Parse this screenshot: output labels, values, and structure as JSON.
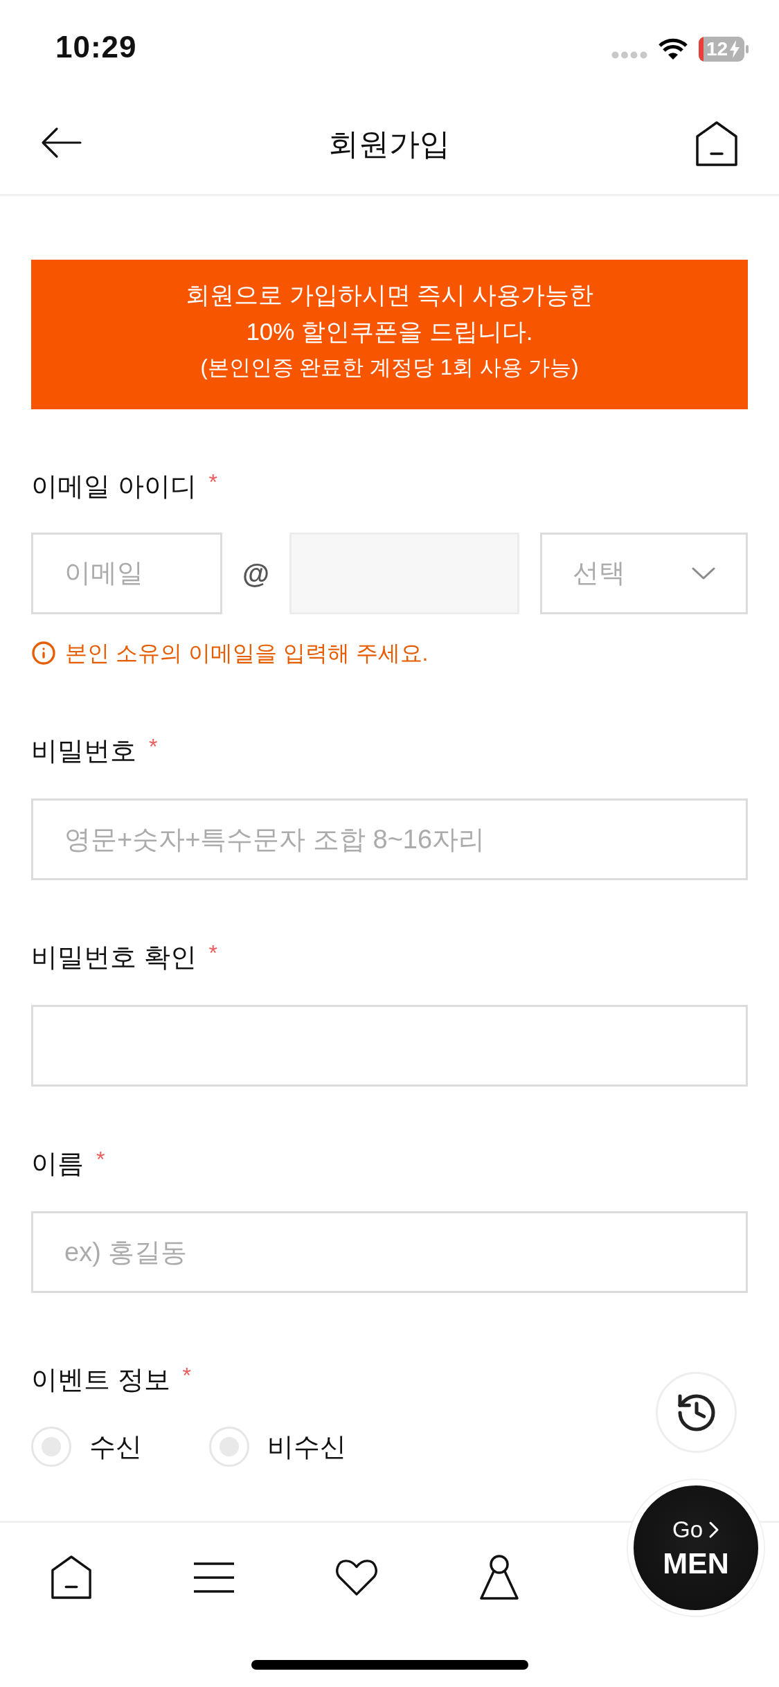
{
  "status_bar": {
    "time": "10:29",
    "battery": "12"
  },
  "header": {
    "title": "회원가입"
  },
  "banner": {
    "message_lines": [
      "회원으로 가입하시면 즉시 사용가능한",
      "10% 할인쿠폰을 드립니다."
    ],
    "note": "(본인인증 완료한 계정당 1회 사용 가능)"
  },
  "fields": [
    {
      "kind": "email",
      "label": "이메일 아이디",
      "mark": "*",
      "local": {
        "placeholder": "이메일"
      },
      "separator": "@",
      "domain": {
        "disabled": true
      },
      "select": {
        "placeholder": "선택"
      },
      "hint": "본인 소유의 이메일을 입력해 주세요."
    },
    {
      "kind": "text",
      "label": "비밀번호",
      "mark": "*",
      "placeholder": "영문+숫자+특수문자 조합 8~16자리"
    },
    {
      "kind": "text",
      "label": "비밀번호 확인",
      "mark": "*"
    },
    {
      "kind": "text",
      "label": "이름",
      "mark": "*",
      "placeholder": "ex) 홍길동"
    },
    {
      "kind": "radio",
      "label": "이벤트 정보",
      "mark": "*",
      "options": [
        {
          "label": "수신",
          "selected": false
        },
        {
          "label": "비수신",
          "selected": false
        }
      ]
    }
  ],
  "go_button": {
    "prefix": "Go",
    "label": "MEN"
  }
}
